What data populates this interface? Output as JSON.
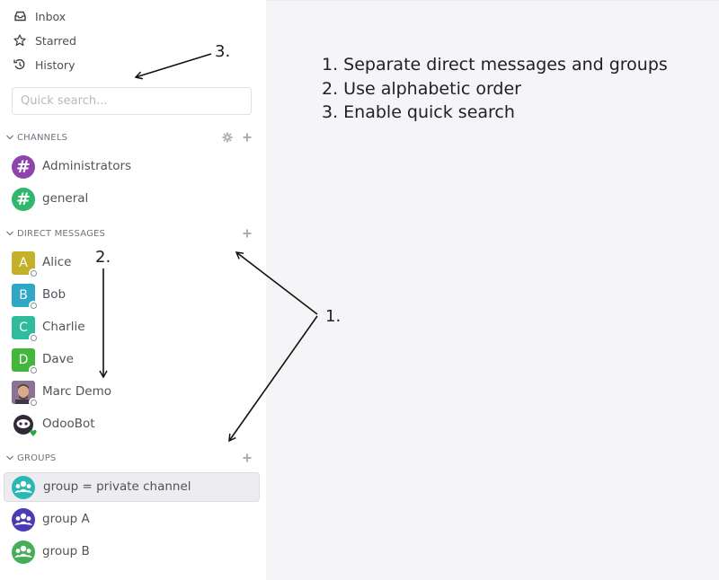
{
  "nav": {
    "inbox": "Inbox",
    "starred": "Starred",
    "history": "History"
  },
  "search": {
    "placeholder": "Quick search..."
  },
  "sections": {
    "channels": {
      "title": "CHANNELS",
      "items": [
        {
          "name": "Administrators",
          "color": "#8e44ad"
        },
        {
          "name": "general",
          "color": "#2fb86b"
        }
      ]
    },
    "direct_messages": {
      "title": "DIRECT MESSAGES",
      "items": [
        {
          "initial": "A",
          "name": "Alice",
          "color": "#c4b12a",
          "status": "offline"
        },
        {
          "initial": "B",
          "name": "Bob",
          "color": "#2ea8c4",
          "status": "offline"
        },
        {
          "initial": "C",
          "name": "Charlie",
          "color": "#2ebc9c",
          "status": "offline"
        },
        {
          "initial": "D",
          "name": "Dave",
          "color": "#45b63c",
          "status": "offline"
        },
        {
          "initial": "",
          "name": "Marc Demo",
          "color": "#7a5a8a",
          "status": "offline"
        },
        {
          "initial": "",
          "name": "OdooBot",
          "color": "#6b5977",
          "status": "online"
        }
      ]
    },
    "groups": {
      "title": "GROUPS",
      "items": [
        {
          "name": "group = private channel",
          "color": "#2bb7b3",
          "active": true
        },
        {
          "name": "group A",
          "color": "#4b3bb5",
          "active": false
        },
        {
          "name": "group B",
          "color": "#47ad58",
          "active": false
        }
      ]
    }
  },
  "annotations": {
    "list": [
      "1. Separate direct messages and groups",
      "2. Use alphabetic order",
      "3. Enable quick search"
    ],
    "label_1": "1.",
    "label_2": "2.",
    "label_3": "3."
  }
}
